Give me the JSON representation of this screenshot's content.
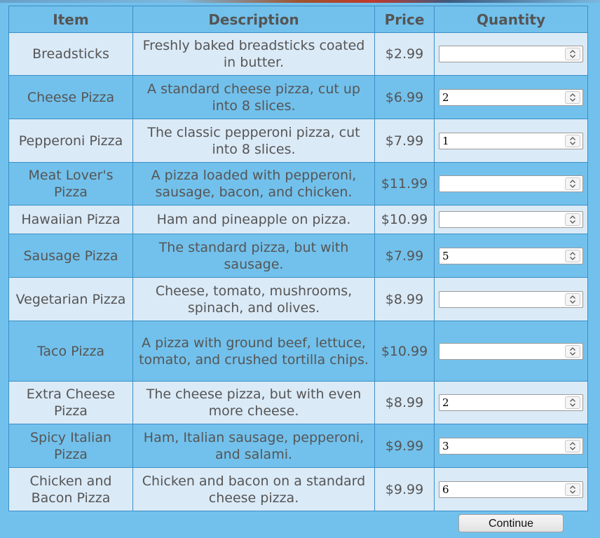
{
  "table": {
    "headers": [
      "Item",
      "Description",
      "Price",
      "Quantity"
    ],
    "rows": [
      {
        "item": "Breadsticks",
        "description": "Freshly baked breadsticks coated in butter.",
        "price": "$2.99",
        "quantity": ""
      },
      {
        "item": "Cheese Pizza",
        "description": "A standard cheese pizza, cut up into 8 slices.",
        "price": "$6.99",
        "quantity": "2"
      },
      {
        "item": "Pepperoni Pizza",
        "description": "The classic pepperoni pizza, cut into 8 slices.",
        "price": "$7.99",
        "quantity": "1"
      },
      {
        "item": "Meat Lover's Pizza",
        "description": "A pizza loaded with pepperoni, sausage, bacon, and chicken.",
        "price": "$11.99",
        "quantity": ""
      },
      {
        "item": "Hawaiian Pizza",
        "description": "Ham and pineapple on pizza.",
        "price": "$10.99",
        "quantity": ""
      },
      {
        "item": "Sausage Pizza",
        "description": "The standard pizza, but with sausage.",
        "price": "$7.99",
        "quantity": "5"
      },
      {
        "item": "Vegetarian Pizza",
        "description": "Cheese, tomato, mushrooms, spinach, and olives.",
        "price": "$8.99",
        "quantity": ""
      },
      {
        "item": "Taco Pizza",
        "description": "A pizza with ground beef, lettuce, tomato, and crushed tortilla chips.",
        "price": "$10.99",
        "quantity": ""
      },
      {
        "item": "Extra Cheese Pizza",
        "description": "The cheese pizza, but with even more cheese.",
        "price": "$8.99",
        "quantity": "2"
      },
      {
        "item": "Spicy Italian Pizza",
        "description": "Ham, Italian sausage, pepperoni, and salami.",
        "price": "$9.99",
        "quantity": "3"
      },
      {
        "item": "Chicken and Bacon Pizza",
        "description": "Chicken and bacon on a standard cheese pizza.",
        "price": "$9.99",
        "quantity": "6"
      }
    ]
  },
  "continue_label": "Continue",
  "icons": {
    "spinner": "up-down-chevron-icon"
  },
  "colors": {
    "page_bg": "#72c1ec",
    "alt_row": "#dbeaf7",
    "border": "#3a8fc6",
    "text": "#555555"
  }
}
